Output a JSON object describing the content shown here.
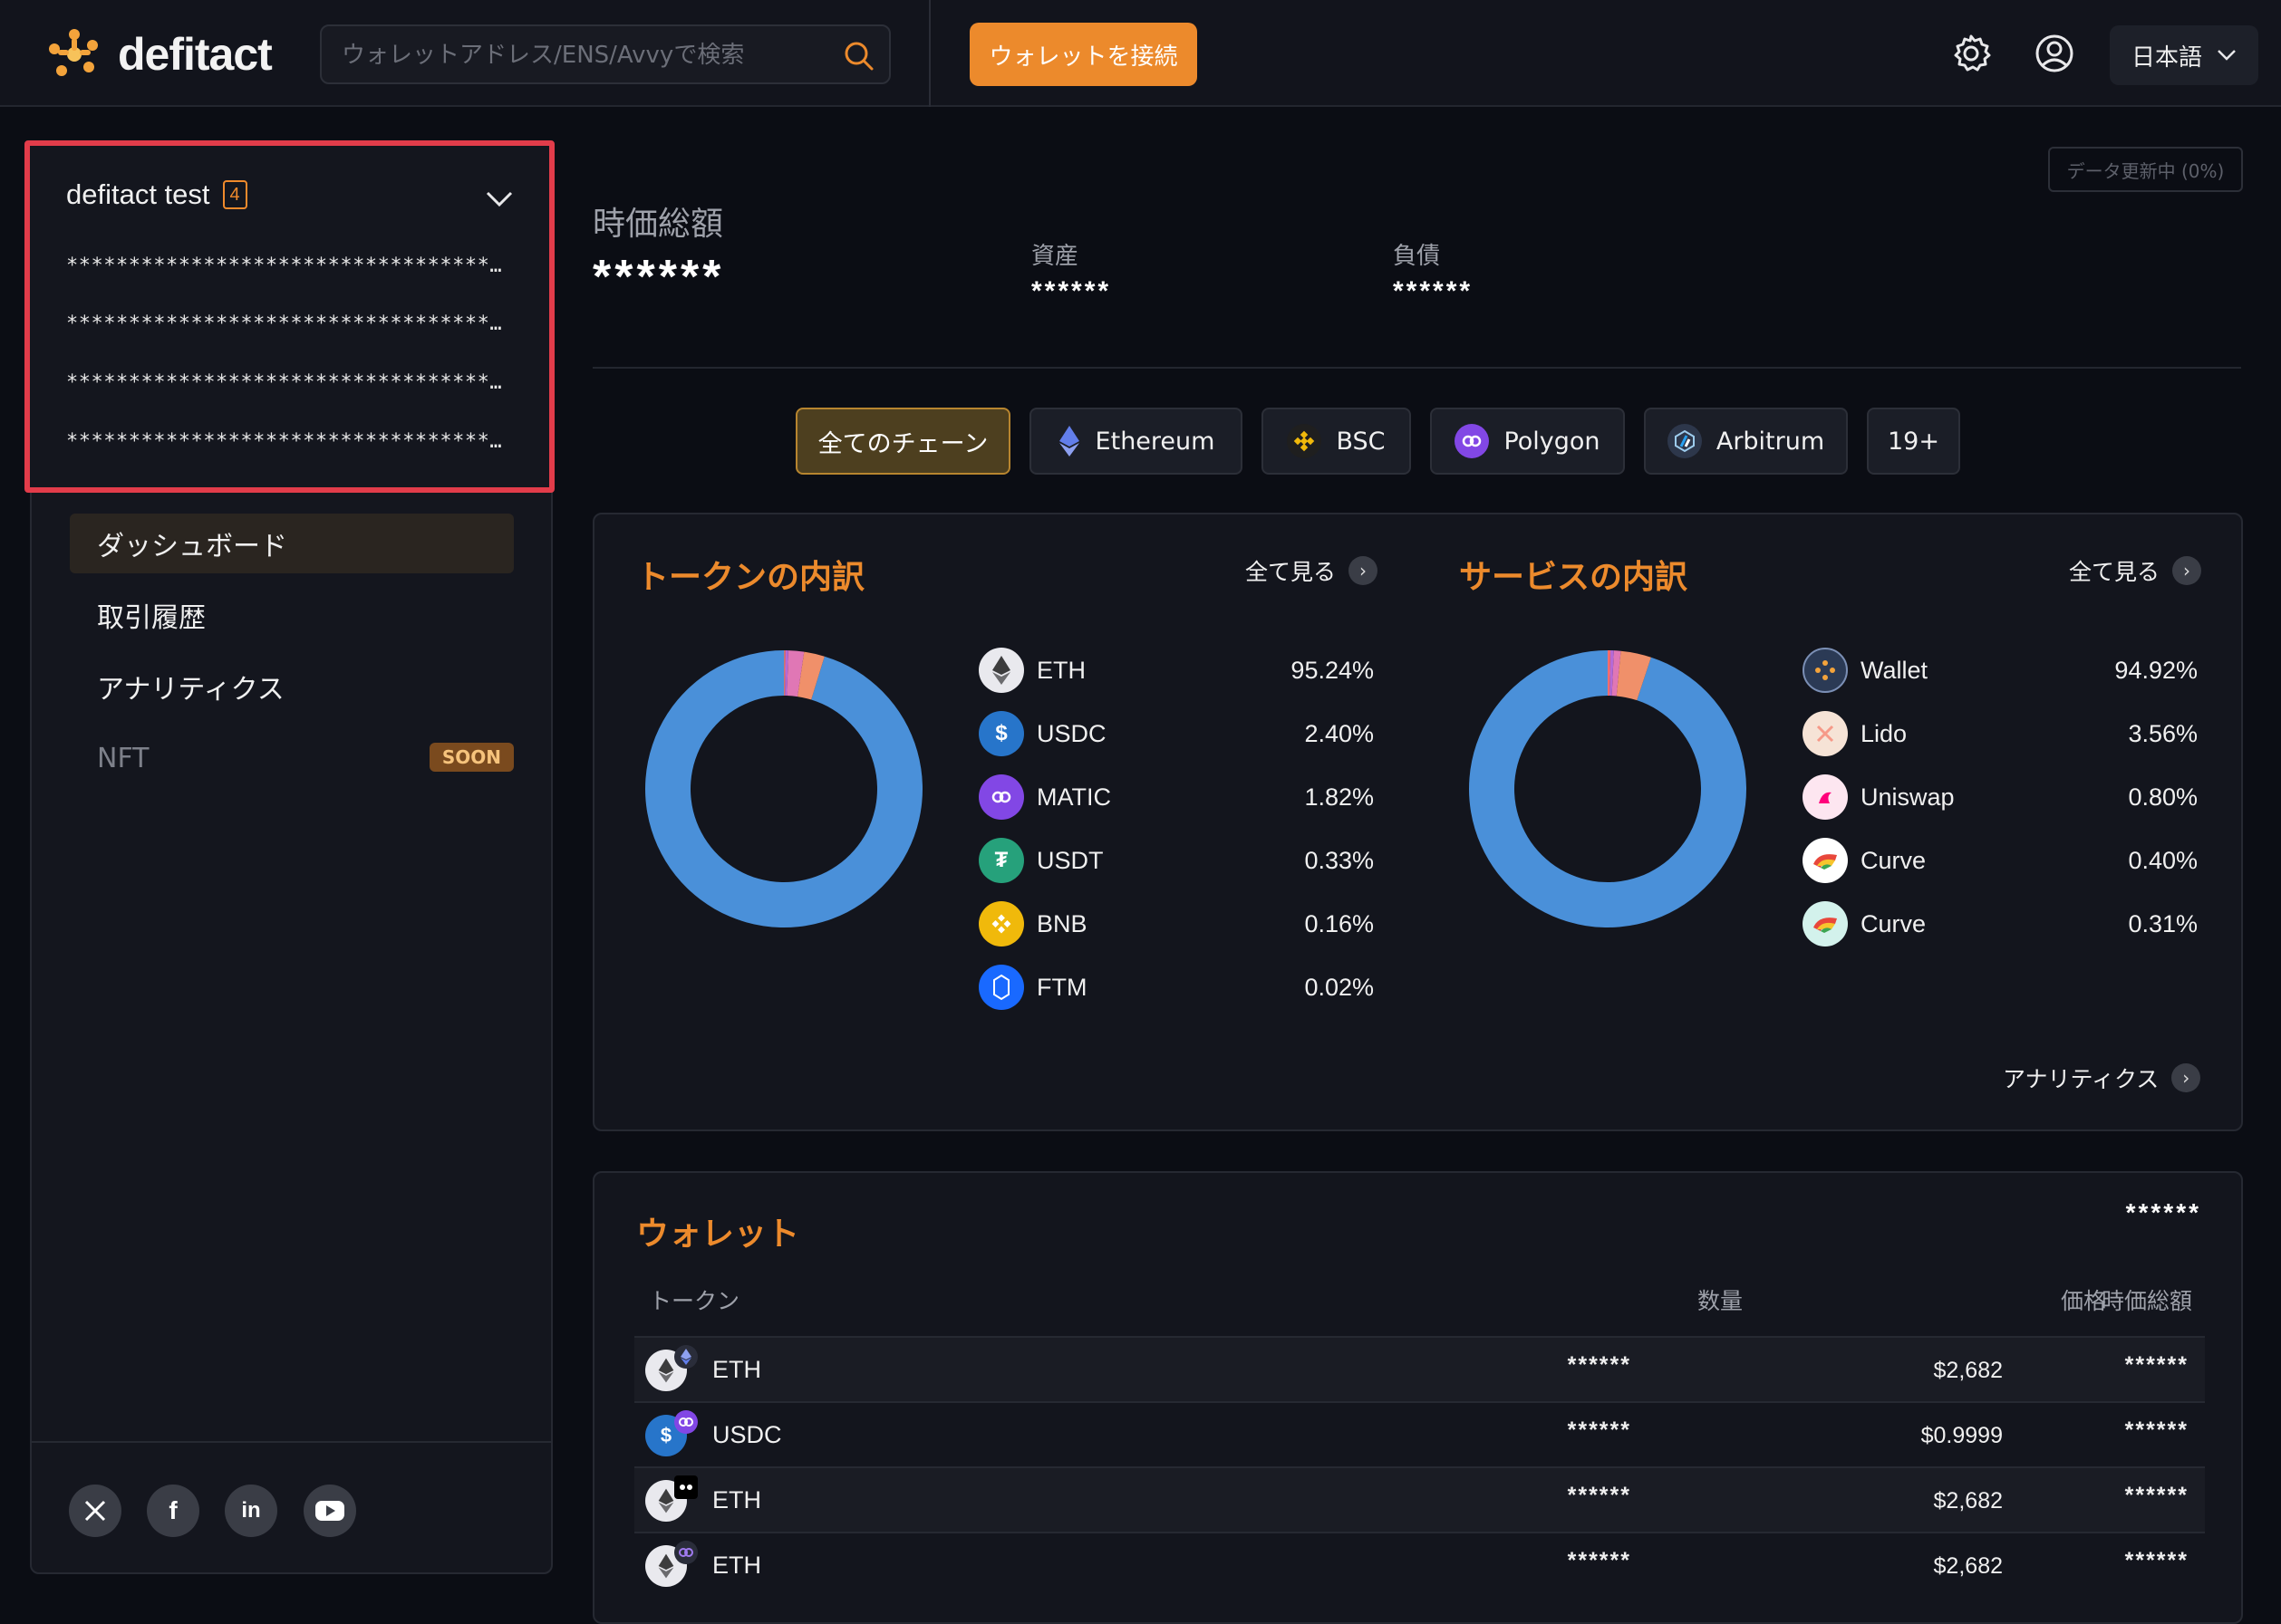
{
  "header": {
    "logo_text": "defitact",
    "search_placeholder": "ウォレットアドレス/ENS/Avvyで検索",
    "connect_label": "ウォレットを接続",
    "language": "日本語",
    "icons": [
      "gear-icon",
      "user-icon",
      "search-icon",
      "chevron-down-icon"
    ]
  },
  "sidebar": {
    "account_name": "defitact test",
    "account_count": "4",
    "addresses": [
      "**********************************…",
      "**********************************…",
      "**********************************…",
      "**********************************…"
    ],
    "nav": [
      {
        "label": "ダッシュボード"
      },
      {
        "label": "取引履歴"
      },
      {
        "label": "アナリティクス"
      },
      {
        "label": "NFT",
        "badge": "SOON"
      }
    ],
    "social": [
      "x-icon",
      "facebook-icon",
      "linkedin-icon",
      "youtube-icon"
    ]
  },
  "summary": {
    "updating_label": "データ更新中 (0%)",
    "total_label": "時価総額",
    "total_value": "******",
    "assets_label": "資産",
    "assets_value": "******",
    "liabilities_label": "負債",
    "liabilities_value": "******"
  },
  "chains": [
    {
      "label": "全てのチェーン"
    },
    {
      "label": "Ethereum",
      "color": "#627eea"
    },
    {
      "label": "BSC",
      "color": "#f0b90b"
    },
    {
      "label": "Polygon",
      "color": "#8247e5"
    },
    {
      "label": "Arbitrum",
      "color": "#28a0f0"
    },
    {
      "label": "19+"
    }
  ],
  "token_breakdown": {
    "title": "トークンの内訳",
    "see_all": "全て見る",
    "items": [
      {
        "name": "ETH",
        "pct": "95.24%",
        "value": 95.24,
        "color": "#4a90d9"
      },
      {
        "name": "USDC",
        "pct": "2.40%",
        "value": 2.4,
        "color": "#f0906a"
      },
      {
        "name": "MATIC",
        "pct": "1.82%",
        "value": 1.82,
        "color": "#e077b5"
      },
      {
        "name": "USDT",
        "pct": "0.33%",
        "value": 0.33,
        "color": "#b56ad6"
      },
      {
        "name": "BNB",
        "pct": "0.16%",
        "value": 0.16,
        "color": "#ff6d6d"
      },
      {
        "name": "FTM",
        "pct": "0.02%",
        "value": 0.02,
        "color": "#6adbb0"
      }
    ]
  },
  "service_breakdown": {
    "title": "サービスの内訳",
    "see_all": "全て見る",
    "analytics_link": "アナリティクス",
    "items": [
      {
        "name": "Wallet",
        "pct": "94.92%",
        "value": 94.92,
        "color": "#4a90d9"
      },
      {
        "name": "Lido",
        "pct": "3.56%",
        "value": 3.56,
        "color": "#f0906a"
      },
      {
        "name": "Uniswap",
        "pct": "0.80%",
        "value": 0.8,
        "color": "#e077b5"
      },
      {
        "name": "Curve",
        "pct": "0.40%",
        "value": 0.4,
        "color": "#b56ad6"
      },
      {
        "name": "Curve",
        "pct": "0.31%",
        "value": 0.31,
        "color": "#ff6d6d"
      }
    ]
  },
  "wallet": {
    "title": "ウォレット",
    "total": "******",
    "columns": [
      "トークン",
      "数量",
      "価格",
      "時価総額"
    ],
    "rows": [
      {
        "token": "ETH",
        "qty": "******",
        "price": "$2,682",
        "value": "******"
      },
      {
        "token": "USDC",
        "qty": "******",
        "price": "$0.9999",
        "value": "******"
      },
      {
        "token": "ETH",
        "qty": "******",
        "price": "$2,682",
        "value": "******"
      },
      {
        "token": "ETH",
        "qty": "******",
        "price": "$2,682",
        "value": "******"
      }
    ]
  }
}
